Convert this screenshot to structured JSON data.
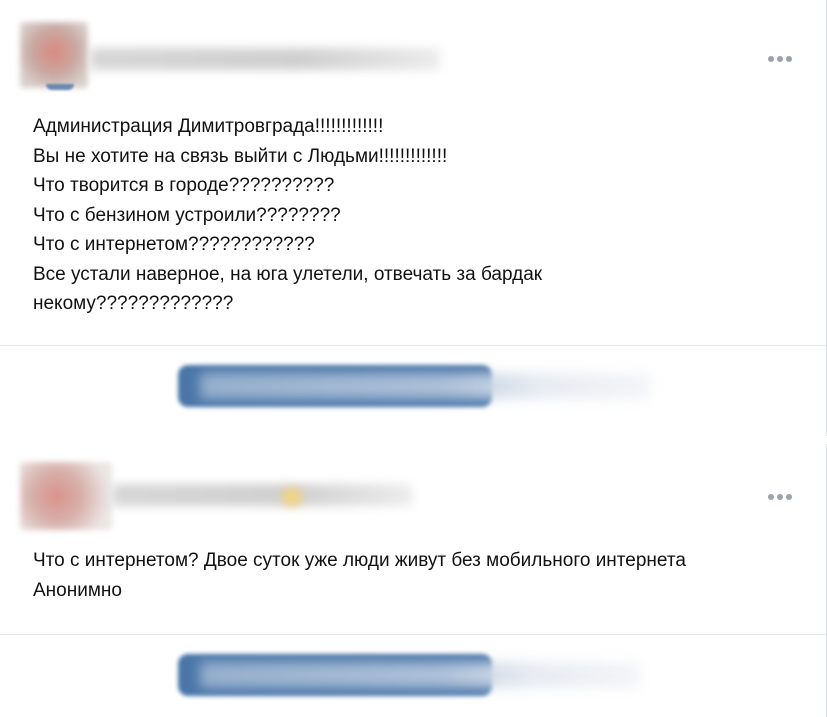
{
  "posts": [
    {
      "author_name": "",
      "menu_icon": "more-horizontal-icon",
      "text_lines": [
        "Администрация Димитровграда!!!!!!!!!!!!!",
        "Вы не хотите на связь выйти с Людьми!!!!!!!!!!!!!",
        "Что творится в городе??????????",
        "Что с бензином устроили????????",
        "Что с интернетом????????????",
        "Все устали наверное, на юга улетели, отвечать за бардак",
        "некому?????????????"
      ],
      "action_label": ""
    },
    {
      "author_name": "",
      "menu_icon": "more-horizontal-icon",
      "text_lines": [
        "Что с интернетом? Двое суток уже люди живут без мобильного интернета",
        "Анонимно"
      ],
      "action_label": ""
    }
  ],
  "colors": {
    "accent": "#4a76a8",
    "menu_dots": "#99a2ad",
    "divider": "#e7e8ec",
    "text": "#111111"
  }
}
